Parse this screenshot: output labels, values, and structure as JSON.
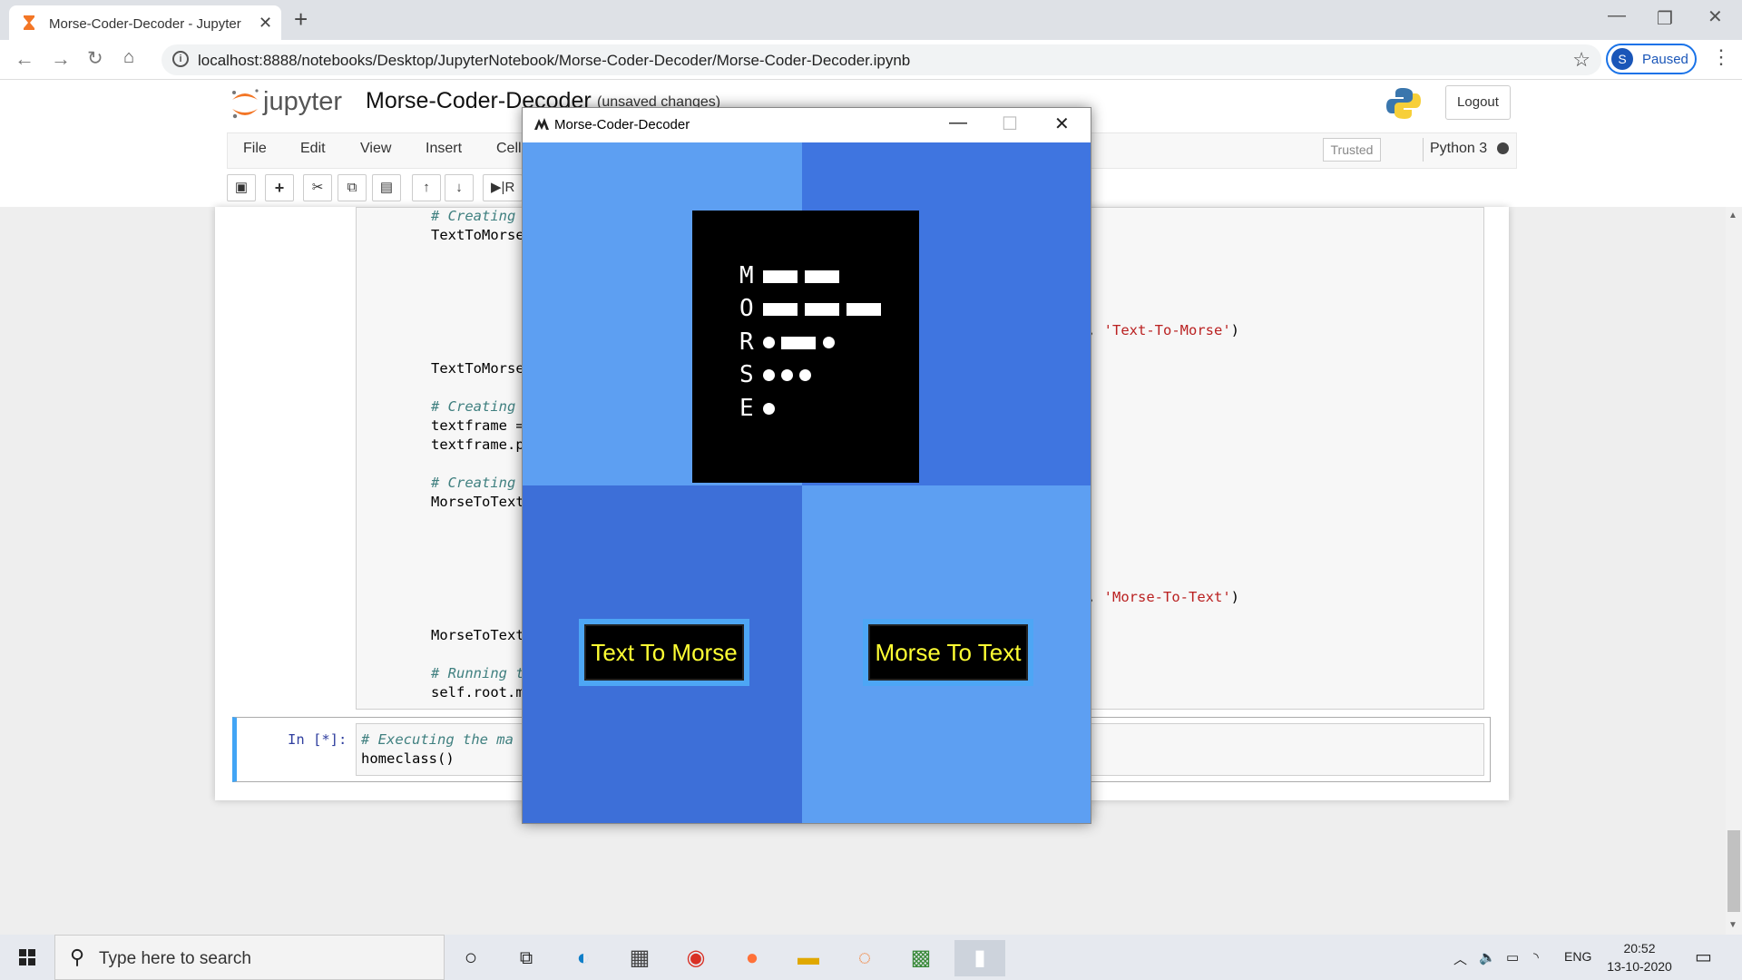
{
  "browser": {
    "tab_title": "Morse-Coder-Decoder - Jupyter",
    "url": "localhost:8888/notebooks/Desktop/JupyterNotebook/Morse-Coder-Decoder/Morse-Coder-Decoder.ipynb",
    "profile_initial": "S",
    "profile_label": "Paused",
    "new_tab": "+",
    "close_tab": "✕"
  },
  "jupyter": {
    "logo_text": "jupyter",
    "notebook_name": "Morse-Coder-Decoder",
    "unsaved": "(unsaved changes)",
    "logout": "Logout",
    "menu": [
      "File",
      "Edit",
      "View",
      "Insert",
      "Cell"
    ],
    "trusted": "Trusted",
    "kernel": "Python 3",
    "run_label": "R"
  },
  "code": {
    "lines": [
      {
        "text": "# Creating",
        "cls": "cm"
      },
      {
        "text": "TextToMorse",
        "cls": ""
      },
      {
        "text": "TextToMorse",
        "cls": ""
      },
      {
        "text": "# Creating",
        "cls": "cm"
      },
      {
        "text": "textframe =",
        "cls": ""
      },
      {
        "text": "textframe.p",
        "cls": ""
      },
      {
        "text": "# Creating",
        "cls": "cm"
      },
      {
        "text": "MorseToText",
        "cls": ""
      },
      {
        "text": "MorseToText",
        "cls": ""
      },
      {
        "text": "# Running t",
        "cls": "cm"
      },
      {
        "text": "self.root.m",
        "cls": ""
      }
    ],
    "right1_prefix": ", ",
    "right1_str": "'Text-To-Morse'",
    "right1_suffix": ")",
    "right2_prefix": ", ",
    "right2_str": "'Morse-To-Text'",
    "right2_suffix": ")",
    "prompt": "In [*]:",
    "cell2_line1": "# Executing the ma",
    "cell2_line2": "homeclass()"
  },
  "tkwindow": {
    "title": "Morse-Coder-Decoder",
    "btn_text_to_morse": "Text To Morse",
    "btn_morse_to_text": "Morse To Text",
    "logo_letters": [
      "M",
      "O",
      "R",
      "S",
      "E"
    ]
  },
  "taskbar": {
    "search_placeholder": "Type here to search",
    "lang": "ENG",
    "time": "20:52",
    "date": "13-10-2020"
  }
}
